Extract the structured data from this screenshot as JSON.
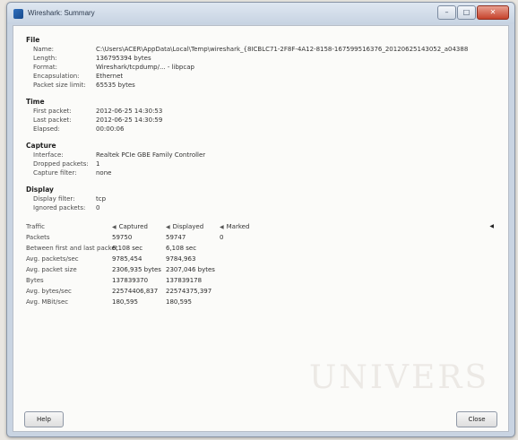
{
  "window": {
    "title": "Wireshark: Summary",
    "controls": {
      "minimize": "–",
      "maximize": "□",
      "close": "✕"
    }
  },
  "file": {
    "heading": "File",
    "fields": [
      {
        "label": "Name:",
        "value": "C:\\Users\\ACER\\AppData\\Local\\Temp\\wireshark_{8ICBLC71-2F8F-4A12-8158-167599516376_20120625143052_a04388"
      },
      {
        "label": "Length:",
        "value": "136795394 bytes"
      },
      {
        "label": "Format:",
        "value": "Wireshark/tcpdump/... - libpcap"
      },
      {
        "label": "Encapsulation:",
        "value": "Ethernet"
      },
      {
        "label": "Packet size limit:",
        "value": "65535 bytes"
      }
    ]
  },
  "time": {
    "heading": "Time",
    "fields": [
      {
        "label": "First packet:",
        "value": "2012-06-25 14:30:53"
      },
      {
        "label": "Last packet:",
        "value": "2012-06-25 14:30:59"
      },
      {
        "label": "Elapsed:",
        "value": "00:00:06"
      }
    ]
  },
  "capture": {
    "heading": "Capture",
    "fields": [
      {
        "label": "Interface:",
        "value": "Realtek PCIe GBE Family Controller"
      },
      {
        "label": "Dropped packets:",
        "value": "1"
      },
      {
        "label": "Capture filter:",
        "value": "none"
      }
    ]
  },
  "display": {
    "heading": "Display",
    "fields": [
      {
        "label": "Display filter:",
        "value": "tcp"
      },
      {
        "label": "Ignored packets:",
        "value": "0"
      }
    ]
  },
  "traffic": {
    "headers": {
      "traffic": "Traffic",
      "captured": "Captured",
      "displayed": "Displayed",
      "marked": "Marked"
    },
    "rows": [
      {
        "label": "Packets",
        "captured": "59750",
        "displayed": "59747",
        "marked": "0"
      },
      {
        "label": "Between first and last packet",
        "captured": "6,108 sec",
        "displayed": "6,108 sec",
        "marked": ""
      },
      {
        "label": "Avg. packets/sec",
        "captured": "9785,454",
        "displayed": "9784,963",
        "marked": ""
      },
      {
        "label": "Avg. packet size",
        "captured": "2306,935 bytes",
        "displayed": "2307,046 bytes",
        "marked": ""
      },
      {
        "label": "Bytes",
        "captured": "137839370",
        "displayed": "137839178",
        "marked": ""
      },
      {
        "label": "Avg. bytes/sec",
        "captured": "22574406,837",
        "displayed": "22574375,397",
        "marked": ""
      },
      {
        "label": "Avg. MBit/sec",
        "captured": "180,595",
        "displayed": "180,595",
        "marked": ""
      }
    ]
  },
  "buttons": {
    "help": "Help",
    "close": "Close"
  },
  "watermark": "UNIVERS"
}
